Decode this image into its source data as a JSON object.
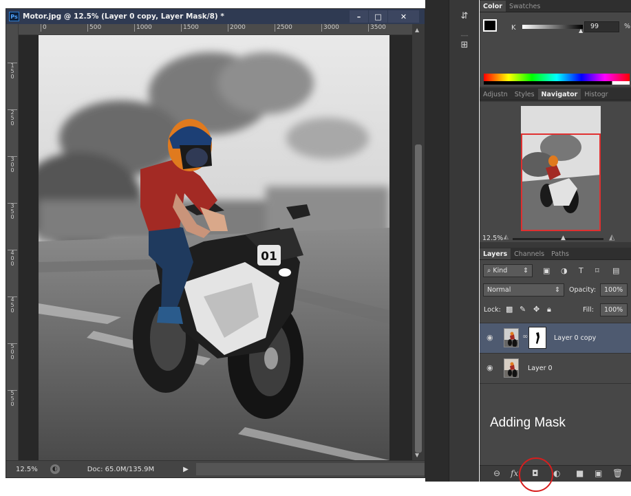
{
  "document": {
    "badge": "Ps",
    "title": "Motor.jpg @ 12.5% (Layer 0 copy, Layer Mask/8) *",
    "ruler_top": [
      "0",
      "500",
      "1000",
      "1500",
      "2000",
      "2500",
      "3000",
      "3500"
    ],
    "ruler_left": [
      "1\n5\n0",
      "2\n5\n0",
      "3\n0\n0",
      "3\n5\n0",
      "4\n0\n0",
      "4\n5\n0",
      "5\n0\n0",
      "5\n5\n0"
    ],
    "zoom": "12.5%",
    "doc_size": "Doc: 65.0M/135.9M",
    "photo_plate": "01"
  },
  "window_buttons": {
    "minimize": "–",
    "maximize": "□",
    "close": "✕"
  },
  "color_panel": {
    "tabs": [
      "Color",
      "Swatches"
    ],
    "channel_label": "K",
    "channel_value": "99",
    "channel_unit": "%",
    "foreground": "#000000",
    "background": "#ffffff"
  },
  "navigator_panel": {
    "tabs": [
      "Adjustn",
      "Styles",
      "Navigator",
      "Histogr"
    ],
    "zoom": "12.5%"
  },
  "layers_panel": {
    "tabs": [
      "Layers",
      "Channels",
      "Paths"
    ],
    "filter_kind": "Kind",
    "blend_mode": "Normal",
    "opacity_label": "Opacity:",
    "opacity_value": "100%",
    "lock_label": "Lock:",
    "fill_label": "Fill:",
    "fill_value": "100%",
    "layers": [
      {
        "name": "Layer 0 copy",
        "selected": true,
        "has_mask": true
      },
      {
        "name": "Layer 0",
        "selected": false,
        "has_mask": false
      }
    ]
  },
  "annotation": "Adding Mask",
  "colors": {
    "highlight_circle": "#d81e1e",
    "navigator_proxy": "#e03030",
    "selected_layer": "#4e5a70"
  }
}
